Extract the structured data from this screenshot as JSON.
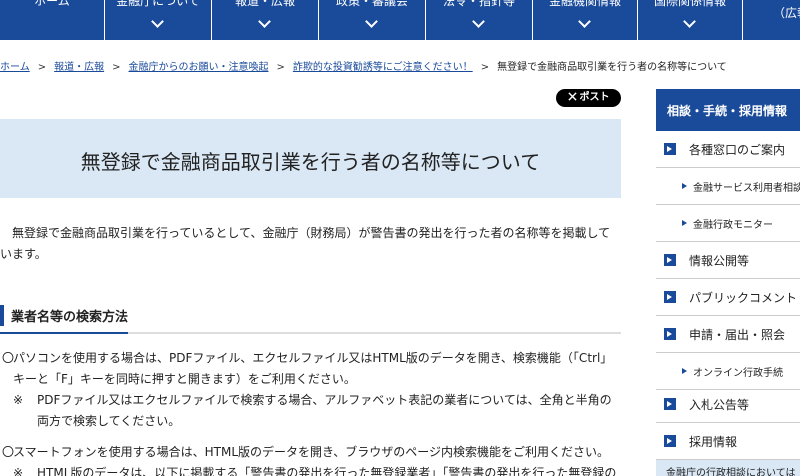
{
  "nav": {
    "items": [
      {
        "label": "ホーム",
        "chevron": false
      },
      {
        "label": "金融庁について",
        "chevron": true
      },
      {
        "label": "報道・広報",
        "chevron": true
      },
      {
        "label": "政策・審議会",
        "chevron": true
      },
      {
        "label": "法令・指針等",
        "chevron": true
      },
      {
        "label": "金融機関情報",
        "chevron": true
      },
      {
        "label": "国際関係情報",
        "chevron": true
      },
      {
        "label": "（広報",
        "chevron": false
      }
    ]
  },
  "breadcrumb": {
    "home": "ホーム",
    "l1": "報道・広報",
    "l2": "金融庁からのお願い・注意喚起",
    "l3": "詐欺的な投資勧誘等にご注意ください！",
    "current": "無登録で金融商品取引業を行う者の名称等について",
    "sep": ">"
  },
  "post_button": "ポスト",
  "page_title": "無登録で金融商品取引業を行う者の名称等について",
  "intro_text": "無登録で金融商品取引業を行っているとして、金融庁（財務局）が警告書の発出を行った者の名称等を掲載しています。",
  "section_title": "業者名等の検索方法",
  "items": [
    {
      "mark": "〇",
      "text": "パソコンを使用する場合は、PDFファイル、エクセルファイル又はHTML版のデータを開き、検索機能（「Ctrl」キーと「F」キーを同時に押すと開きます）をご利用ください。",
      "note_mark": "※",
      "note": "PDFファイル又はエクセルファイルで検索する場合、アルファベット表記の業者については、全角と半角の両方で検索してください。"
    },
    {
      "mark": "〇",
      "text": "スマートフォンを使用する場合は、HTML版のデータを開き、ブラウザのページ内検索機能をご利用ください。",
      "note_mark": "※",
      "note": "HTML版のデータは、以下に掲載する「警告書の発出を行った無登録業者」「警告書の発出を行った無登録の"
    }
  ],
  "sidebar": {
    "heading": "相談・手続・採用情報",
    "items": [
      {
        "label": "各種窓口のご案内",
        "sub": false
      },
      {
        "label": "金融サービス利用者相談室",
        "sub": true
      },
      {
        "label": "金融行政モニター",
        "sub": true
      },
      {
        "label": "情報公開等",
        "sub": false
      },
      {
        "label": "パブリックコメント",
        "sub": false
      },
      {
        "label": "申請・届出・照会",
        "sub": false
      },
      {
        "label": "オンライン行政手続",
        "sub": true
      },
      {
        "label": "入札公告等",
        "sub": false
      },
      {
        "label": "採用情報",
        "sub": false
      }
    ],
    "footer": "金融庁の行政相談においては"
  },
  "colors": {
    "brand": "#1a4a9a",
    "banner": "#dae8f6"
  }
}
